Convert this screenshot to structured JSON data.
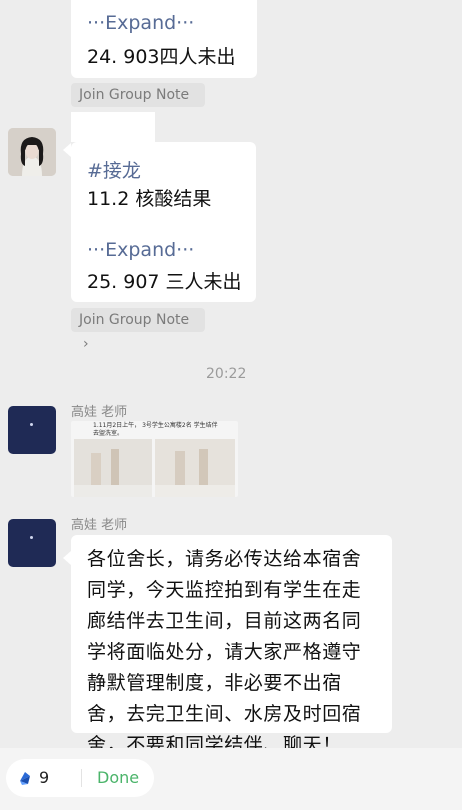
{
  "messages": {
    "m1": {
      "expand": "···Expand···",
      "line": "24. 903四人未出",
      "note_chip": "Join Group Note"
    },
    "m2": {
      "tag": "#接龙",
      "line1": "11.2 核酸结果",
      "expand": "···Expand···",
      "line2": "25. 907 三人未出",
      "note_chip": "Join Group Note"
    },
    "timestamp": "20:22",
    "m3": {
      "sender": "高娃 老师",
      "image_caption": "1.11月2日上午， 3号学生公寓楼2名 学生结伴去盥洗室。"
    },
    "m4": {
      "sender": "高娃 老师",
      "lines": [
        "各位舍长，请务必传达给本宿舍",
        "同学，今天监控拍到有学生在走",
        "廊结伴去卫生间，目前这两名同",
        "学将面临处分，请大家严格遵守",
        "静默管理制度，非必要不出宿",
        "舍，去完卫生间、水房及时回宿",
        "舍，不要和同学结伴、聊天！"
      ]
    }
  },
  "bottom": {
    "count": "9",
    "done_label": "Done"
  },
  "colors": {
    "background": "#ededed",
    "link_blue": "#576b95",
    "done_green": "#4bb46a",
    "avatar_navy": "#1f2a55"
  },
  "icons": {
    "counter_icon": "blue-logo-icon",
    "chip_arrow": "chevron-right-icon"
  }
}
